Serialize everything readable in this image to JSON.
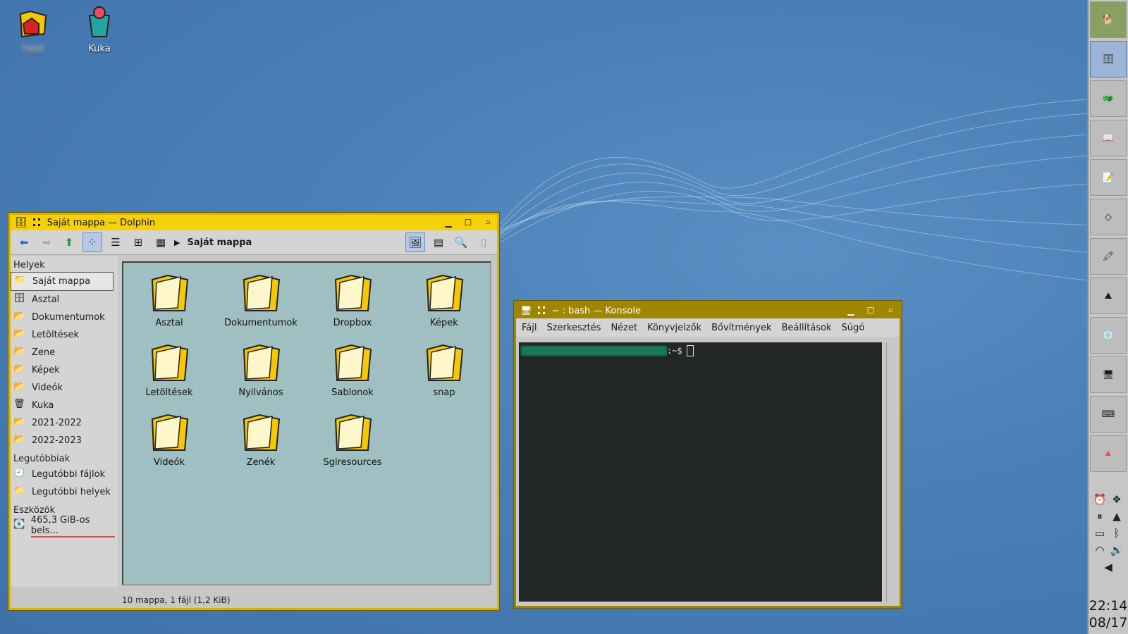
{
  "desktop": {
    "icons": [
      {
        "label": "Sajat"
      },
      {
        "label": "Kuka"
      }
    ]
  },
  "dolphin": {
    "title": "Saját mappa — Dolphin",
    "breadcrumb": "Saját mappa",
    "sidebar": {
      "sections": [
        {
          "header": "Helyek",
          "items": [
            "Saját mappa",
            "Asztal",
            "Dokumentumok",
            "Letöltések",
            "Zene",
            "Képek",
            "Videók",
            "Kuka",
            "2021-2022",
            "2022-2023"
          ]
        },
        {
          "header": "Legutóbbiak",
          "items": [
            "Legutóbbi fájlok",
            "Legutóbbi helyek"
          ]
        },
        {
          "header": "Eszközök",
          "items": [
            "465,3 GiB-os bels..."
          ]
        }
      ]
    },
    "files": [
      "Asztal",
      "Dokumentumok",
      "Dropbox",
      "Képek",
      "Letöltések",
      "Nyilvános",
      "Sablonok",
      "snap",
      "Videók",
      "Zenék",
      "Sgiresources"
    ],
    "status": "10 mappa, 1 fájl (1,2 KiB)"
  },
  "konsole": {
    "title": "~ : bash — Konsole",
    "menu": [
      "Fájl",
      "Szerkesztés",
      "Nézet",
      "Könyvjelzők",
      "Bővítmények",
      "Beállítások",
      "Súgó"
    ],
    "prompt_suffix": ":~$"
  },
  "panel": {
    "time": "22:14",
    "date": "08/17"
  },
  "colors": {
    "titlebar": "#f6d10b",
    "konsole_titlebar": "#a08600",
    "terminal_bg": "#232627",
    "view_bg": "#9fbfc2"
  }
}
